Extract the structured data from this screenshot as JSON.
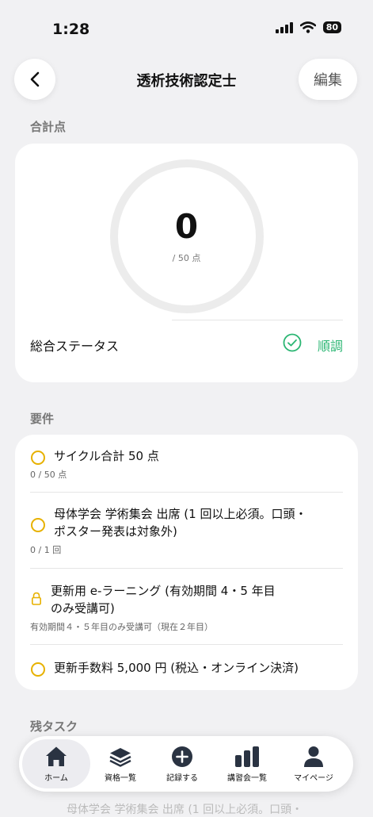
{
  "status_bar": {
    "time": "1:28",
    "battery": "80"
  },
  "nav": {
    "title": "透析技術認定士",
    "edit_label": "編集"
  },
  "total": {
    "section_label": "合計点",
    "score": "0",
    "max_label": "/ 50 点",
    "progress": 0,
    "status_label": "総合ステータス",
    "status_value": "順調",
    "status_color": "#2bb673"
  },
  "requirements": {
    "section_label": "要件",
    "items": [
      {
        "icon": "circle-icon",
        "title": "サイクル合計 50 点",
        "sub": "0 / 50 点"
      },
      {
        "icon": "circle-icon",
        "title_line1": "母体学会 学術集会 出席 (1 回以上必須。口頭・",
        "title_line2": "ポスター発表は対象外)",
        "sub": "0 / 1 回"
      },
      {
        "icon": "lock-icon",
        "title_line1": "更新用 e-ラーニング (有効期間 4・5 年目",
        "title_line2": "のみ受講可)",
        "sub": "有効期間４・５年目のみ受講可（現在２年目）"
      },
      {
        "icon": "circle-icon",
        "title": "更新手数料 5,000 円 (税込・オンライン決済)"
      }
    ]
  },
  "tasks": {
    "section_label": "残タスク",
    "peek_text": "母体学会 学術集会 出席 (1 回以上必須。口頭・"
  },
  "tab_bar": {
    "items": [
      {
        "label": "ホーム",
        "icon": "home-icon",
        "active": true
      },
      {
        "label": "資格一覧",
        "icon": "layers-icon"
      },
      {
        "label": "記録する",
        "icon": "plus-circle-icon"
      },
      {
        "label": "講習会一覧",
        "icon": "bar-chart-icon"
      },
      {
        "label": "マイページ",
        "icon": "person-icon"
      }
    ]
  },
  "colors": {
    "accent_green": "#2bb673",
    "warning_yellow": "#e7b100",
    "background": "#f1f1f3"
  }
}
